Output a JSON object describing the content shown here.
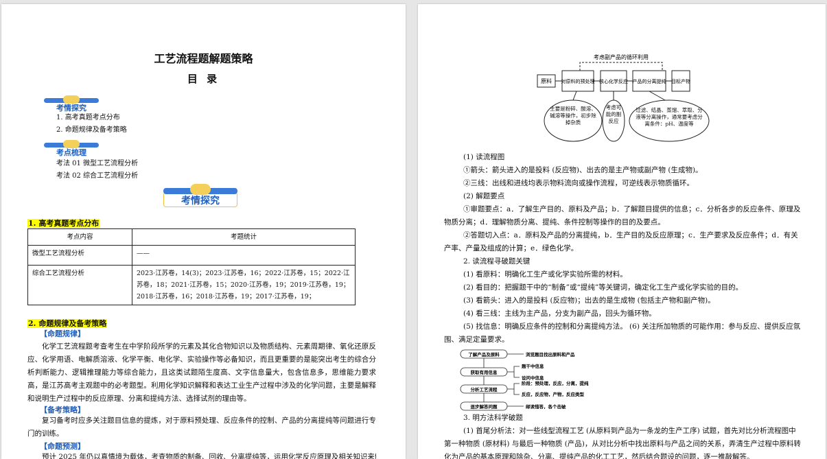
{
  "page1": {
    "title": "工艺流程题解题策略",
    "toc_heading": "目 录",
    "badge1": "考情探究",
    "toc_items": [
      "1.  高考真题考点分布",
      "2.  命题规律及备考策略"
    ],
    "badge2": "考点梳理",
    "points": [
      "考法 01 微型工艺流程分析",
      "考法 02 综合工艺流程分析"
    ],
    "badge3": "考情探究",
    "sec1": "1. 高考真题考点分布",
    "table": {
      "headers": [
        "考点内容",
        "考题统计"
      ],
      "rows": [
        [
          "微型工艺流程分析",
          "——"
        ],
        [
          "综合工艺流程分析",
          "2023·江苏卷，14(3)；2023·江苏卷，16；2022·江苏卷，15；2022·江苏卷，18；2021·江苏卷，15；2020·江苏卷，19；2019·江苏卷，19；2018·江苏卷，16；2018·江苏卷，19；2017·江苏卷，19；"
        ]
      ]
    },
    "sec2": "2. 命题规律及备考策略",
    "sub1": "【命题规律】",
    "para1": "化学工艺流程题考查考生在中学阶段所学的元素及其化合物知识以及物质结构、元素周期律、氧化还原反应、化学用语、电解质溶液、化学平衡、电化学、实验操作等必备知识，而且更重要的是能突出考生的综合分析判断能力、逻辑推理能力等综合能力，且这类试题陌生度高、文字信息量大，包含信息多，思维能力要求高，是江苏高考主观题中的必考题型。利用化学知识解释和表达工业生产过程中涉及的化学问题，主要是解释和说明生产过程中的反应原理、分离和提纯方法、选择试剂的理由等。",
    "sub2": "【备考策略】",
    "para2": "复习备考时应多关注题目信息的提炼，对于原料预处理、反应条件的控制、产品的分离提纯等问题进行专门的训练。",
    "sub3": "【命题预测】",
    "para3": "预计 2025 年仍以真情境为载体，考查物质的制备、回收、分离提纯等，运用化学反应原理及相关知识来解决"
  },
  "page2": {
    "flow": {
      "top_label": "考虑副产品的循环利用",
      "boxes": [
        "原料",
        "对原料的预处理",
        "核心化学反应",
        "产品的分离提纯",
        "目标产物"
      ],
      "ellipses": [
        "主要是粉碎、酸溶、碱溶等操作，初步除掉杂质",
        "考虑可能的副反应",
        "过滤、结晶、蒸馏、萃取、分液等分离操作，通常要考虑分离条件：pH、温度等"
      ]
    },
    "lines1": [
      "(1) 读流程图",
      "①箭头：箭头进入的是投料 (反应物)、出去的是主产物或副产物 (生成物)。",
      "②三线：出线和进线均表示物料流向或操作流程，可逆线表示物质循环。",
      "(2) 解题要点",
      "①审题要点：a．了解生产目的、原料及产品；b．了解题目提供的信息；c．分析各步的反应条件、原理及物质分离；d．理解物质分离、提纯、条件控制等操作的目的及要点。",
      "②答题切入点：a．原料及产品的分离提纯，b．生产目的及反应原理；c．生产要求及反应条件；d．有关产率、产量及组成的计算；e．绿色化学。",
      "2. 读流程寻破题关键",
      "(1) 看原料：明确化工生产或化学实验所需的材料。",
      "(2) 看目的：把握题干中的“制备”或“提纯”等关键词，确定化工生产或化学实验的目的。",
      "(3) 看箭头：进入的是投料 (反应物)；出去的是生成物 (包括主产物和副产物)。",
      "(4) 看三线：主线为主产品，分支为副产品，回头为循环物。",
      "(5) 找信息：明确反应条件的控制和分离提纯方法。 (6) 关注所加物质的可能作用：参与反应、提供反应氛围、满足定量要求。"
    ],
    "mini": {
      "steps": [
        "了解产品及原料",
        "获取有用信息",
        "分析工艺流程",
        "逐步解答问题"
      ],
      "notes": [
        "浏览题目找出原料和产品",
        "题干中信息",
        "设问中信息",
        "阶段：预处理，反应，分离，提纯",
        "反应，反应物，产物，反应类型",
        "邮读惜答，各个击破"
      ]
    },
    "lines2": [
      "3. 明方法科学破题",
      "(1) 首尾分析法：对一些线型流程工艺 (从原料到产品为一条龙的生产工序) 试题，首先对比分析流程图中第一种物质 (原材料) 与最后一种物质 (产品)，从对比分析中找出原料与产品之间的关系，弄清生产过程中原料转化为产品的基本原理和除杂、分离、提纯产品的化工工艺，然后结合题设的问题，逐一推敲解答。"
    ]
  }
}
